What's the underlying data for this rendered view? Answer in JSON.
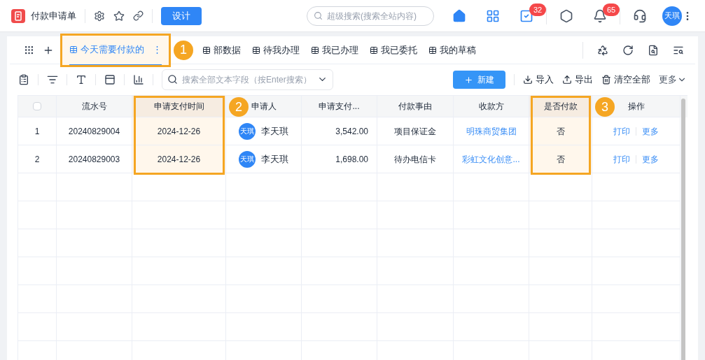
{
  "app_title": "付款申请单",
  "design_button": "设计",
  "global_search": {
    "placeholder": "超级搜索(搜索全站内容)"
  },
  "header_icons": [
    {
      "kind": "home",
      "active": true
    },
    {
      "kind": "apps",
      "active": true
    },
    {
      "kind": "tasks",
      "active": true,
      "badge": "32"
    },
    {
      "kind": "divider"
    },
    {
      "kind": "hexagon",
      "active": false
    },
    {
      "kind": "bell",
      "active": false,
      "badge": "65"
    },
    {
      "kind": "divider"
    },
    {
      "kind": "support",
      "active": false
    }
  ],
  "user_avatar": "天琪",
  "tabs": [
    {
      "label": "今天需要付款的",
      "selected": true,
      "highlighted": true,
      "callout": "1",
      "menu": "⋮"
    },
    {
      "label": "部数据",
      "selected": false,
      "highlighted": false
    },
    {
      "label": "待我办理",
      "selected": false,
      "highlighted": false
    },
    {
      "label": "我已办理",
      "selected": false,
      "highlighted": false
    },
    {
      "label": "我已委托",
      "selected": false,
      "highlighted": false
    },
    {
      "label": "我的草稿",
      "selected": false,
      "highlighted": false
    }
  ],
  "table_search": {
    "placeholder": "搜索全部文本字段（按Enter搜索）"
  },
  "new_button": "新建",
  "actions": [
    {
      "kind": "import",
      "label": "导入"
    },
    {
      "kind": "export",
      "label": "导出"
    },
    {
      "kind": "clear",
      "label": "清空全部"
    }
  ],
  "more_menu": "更多",
  "table": {
    "select_all_checked": false,
    "columns": [
      {
        "label": "流水号",
        "highlighted": false
      },
      {
        "label": "申请支付时间",
        "highlighted": true,
        "callout": "2"
      },
      {
        "label": "申请人",
        "highlighted": false
      },
      {
        "label": "申请支付...",
        "highlighted": false
      },
      {
        "label": "付款事由",
        "highlighted": false
      },
      {
        "label": "收款方",
        "highlighted": false
      },
      {
        "label": "是否付款",
        "highlighted": true,
        "callout": "3"
      },
      {
        "label": "操作",
        "highlighted": false
      }
    ],
    "rows": [
      {
        "index": "1",
        "serial": "20240829004",
        "date": "2024-12-26",
        "avatar": "天琪",
        "applicant": "李天琪",
        "amount": "3,542.00",
        "reason": "项目保证金",
        "payee": "明珠商贸集团",
        "paid": "否",
        "actions": [
          "打印",
          "更多"
        ]
      },
      {
        "index": "2",
        "serial": "20240829003",
        "date": "2024-12-26",
        "avatar": "天琪",
        "applicant": "李天琪",
        "amount": "1,698.00",
        "reason": "待办电信卡",
        "payee": "彩虹文化创意...",
        "paid": "否",
        "actions": [
          "打印",
          "更多"
        ]
      }
    ]
  }
}
